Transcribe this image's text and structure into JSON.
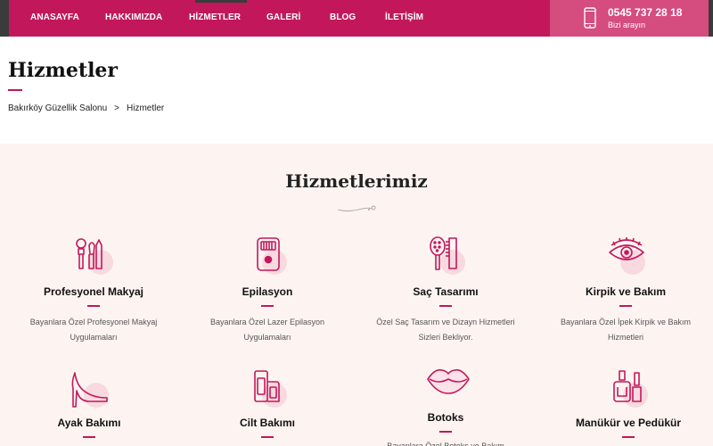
{
  "nav": {
    "items": [
      {
        "label": "ANASAYFA"
      },
      {
        "label": "HAKKIMIZDA"
      },
      {
        "label": "HİZMETLER"
      },
      {
        "label": "GALERİ"
      },
      {
        "label": "BLOG"
      },
      {
        "label": "İLETİŞİM"
      }
    ],
    "active": "HİZMETLER"
  },
  "contact": {
    "phone": "0545 737 28 18",
    "subtitle": "Bizi arayın",
    "icon": "smartphone-icon"
  },
  "page": {
    "title": "Hizmetler",
    "breadcrumb": {
      "home": "Bakırköy Güzellik Salonu",
      "separator": ">",
      "current": "Hizmetler"
    }
  },
  "services": {
    "heading": "Hizmetlerimiz",
    "items": [
      {
        "title": "Profesyonel Makyaj",
        "desc": "Bayanlara Özel Profesyonel Makyaj Uygulamaları",
        "icon": "makeup-brushes-icon"
      },
      {
        "title": "Epilasyon",
        "desc": "Bayanlara Özel Lazer Epilasyon Uygulamaları",
        "icon": "epilator-icon"
      },
      {
        "title": "Saç Tasarımı",
        "desc": "Özel Saç Tasarım ve Dizayn Hizmetleri Sizleri Bekliyor.",
        "icon": "hairbrush-comb-icon"
      },
      {
        "title": "Kirpik ve Bakım",
        "desc": "Bayanlara Özel İpek Kirpik ve Bakım Hizmetleri",
        "icon": "eye-lash-icon"
      },
      {
        "title": "Ayak Bakımı",
        "desc": "",
        "icon": "high-heel-icon"
      },
      {
        "title": "Cilt Bakımı",
        "desc": "",
        "icon": "skincare-tubes-icon"
      },
      {
        "title": "Botoks",
        "desc": "Bayanlara Özel Botoks ve Bakım",
        "icon": "lips-icon"
      },
      {
        "title": "Manükür ve Pedükür",
        "desc": "",
        "icon": "nail-polish-icon"
      }
    ]
  },
  "colors": {
    "brand": "#c2185b",
    "brand_light": "#d54c7e",
    "topbar": "#3b3b3b",
    "section_bg": "#fdf4f2",
    "icon_blob": "#f8d9df"
  }
}
